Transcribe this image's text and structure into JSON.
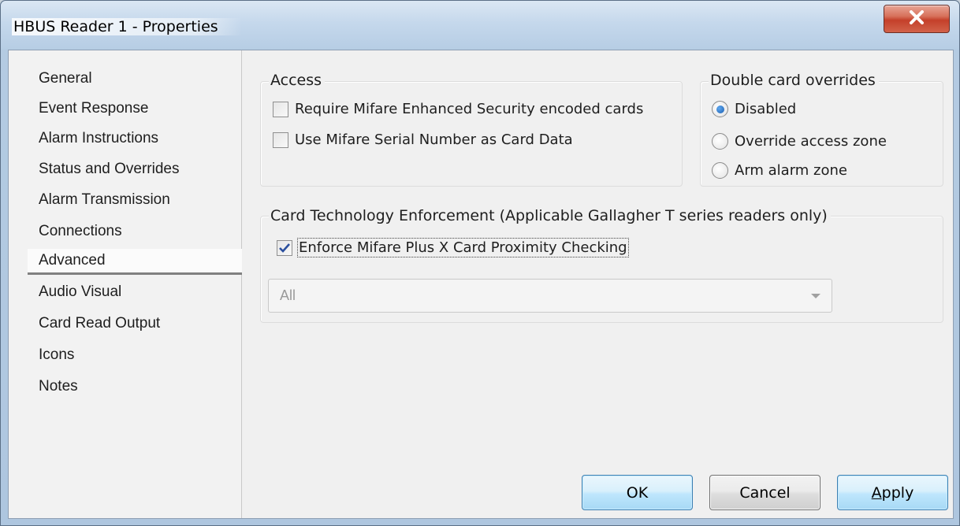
{
  "window": {
    "title": "HBUS Reader 1 - Properties",
    "close_icon": "close-x-icon"
  },
  "sidebar": {
    "items": [
      {
        "label": "General",
        "selected": false
      },
      {
        "label": "Event Response",
        "selected": false
      },
      {
        "label": "Alarm Instructions",
        "selected": false
      },
      {
        "label": "Status and Overrides",
        "selected": false
      },
      {
        "label": "Alarm Transmission",
        "selected": false
      },
      {
        "label": "Connections",
        "selected": false
      },
      {
        "label": "Advanced",
        "selected": true
      },
      {
        "label": "Audio Visual",
        "selected": false
      },
      {
        "label": "Card Read Output",
        "selected": false
      },
      {
        "label": "Icons",
        "selected": false
      },
      {
        "label": "Notes",
        "selected": false
      }
    ]
  },
  "access": {
    "label": "Access",
    "options": [
      {
        "label": "Require Mifare Enhanced Security encoded cards",
        "checked": false
      },
      {
        "label": "Use Mifare Serial Number as Card Data",
        "checked": false
      }
    ]
  },
  "double_card": {
    "label": "Double card overrides",
    "options": [
      {
        "label": "Disabled",
        "selected": true
      },
      {
        "label": "Override access zone",
        "selected": false
      },
      {
        "label": "Arm alarm zone",
        "selected": false
      }
    ]
  },
  "card_tech": {
    "label": "Card Technology Enforcement (Applicable Gallagher T series readers only)",
    "enforce_checkbox": {
      "label": "Enforce Mifare Plus X Card Proximity Checking",
      "checked": true
    },
    "select": {
      "value": "All",
      "disabled": true
    }
  },
  "buttons": {
    "ok": "OK",
    "cancel": "Cancel",
    "apply_prefix": "",
    "apply_mnemonic": "A",
    "apply_rest": "pply"
  },
  "colors": {
    "accent_blue": "#3c7fb1",
    "close_red": "#c4402a",
    "dialog_bg": "#f0f0f0"
  }
}
